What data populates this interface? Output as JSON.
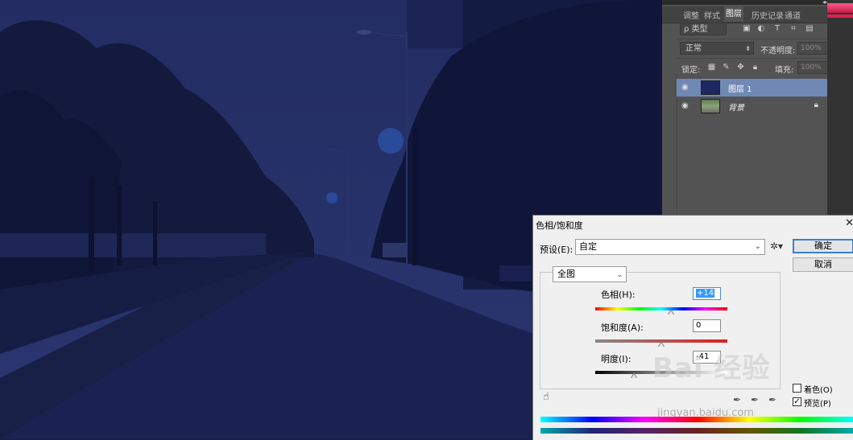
{
  "panel": {
    "tabs": [
      "调整",
      "样式",
      "图层",
      "历史记录",
      "通道"
    ],
    "active_tab": "图层",
    "filter_label": "ρ 类型",
    "blend_mode": "正常",
    "opacity_label": "不透明度:",
    "opacity_value": "100%",
    "lock_label": "锁定:",
    "fill_label": "填充:",
    "fill_value": "100%",
    "layers": [
      {
        "name": "图层 1",
        "selected": true,
        "visible": true,
        "locked": false
      },
      {
        "name": "背景",
        "selected": false,
        "visible": true,
        "locked": true
      }
    ]
  },
  "dialog": {
    "title": "色相/饱和度",
    "preset_label": "预设(E):",
    "preset_value": "自定",
    "ok_label": "确定",
    "cancel_label": "取消",
    "range_value": "全图",
    "hue_label": "色相(H):",
    "hue_value": "+14",
    "saturation_label": "饱和度(A):",
    "saturation_value": "0",
    "lightness_label": "明度(I):",
    "lightness_value": "-41",
    "colorize_label": "着色(O)",
    "colorize_checked": false,
    "preview_label": "预览(P)",
    "preview_checked": true
  },
  "watermark": {
    "brand": "Bai 经验",
    "url": "jingyan.baidu.com"
  },
  "colors": {
    "panel_bg": "#535353",
    "selected_layer": "#6f89b4",
    "canvas_tint": "#1a2456",
    "dialog_bg": "#f0f0f0"
  }
}
